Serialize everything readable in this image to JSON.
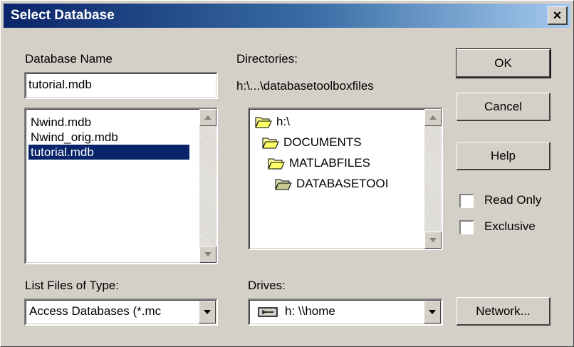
{
  "dialog": {
    "title": "Select Database",
    "close_glyph": "×"
  },
  "database_name": {
    "label": "Database Name",
    "value": "tutorial.mdb",
    "files": [
      "Nwind.mdb",
      "Nwind_orig.mdb",
      "tutorial.mdb"
    ],
    "selected_index": 2
  },
  "directories": {
    "label": "Directories:",
    "current_path": "h:\\...\\databasetoolboxfiles",
    "items": [
      "h:\\",
      "DOCUMENTS",
      "MATLABFILES",
      "DATABASETOOI"
    ]
  },
  "file_type": {
    "label": "List Files of Type:",
    "value": "Access Databases (*.mc"
  },
  "drives": {
    "label": "Drives:",
    "value": "h: \\\\home",
    "icon": "network-drive-icon"
  },
  "buttons": {
    "ok": "OK",
    "cancel": "Cancel",
    "help": "Help",
    "network": "Network..."
  },
  "options": {
    "read_only": "Read Only",
    "exclusive": "Exclusive",
    "read_only_checked": false,
    "exclusive_checked": false
  },
  "colors": {
    "title_start": "#0a246a",
    "title_end": "#a6caf0",
    "selection": "#0a246a",
    "face": "#d4d0c8"
  }
}
